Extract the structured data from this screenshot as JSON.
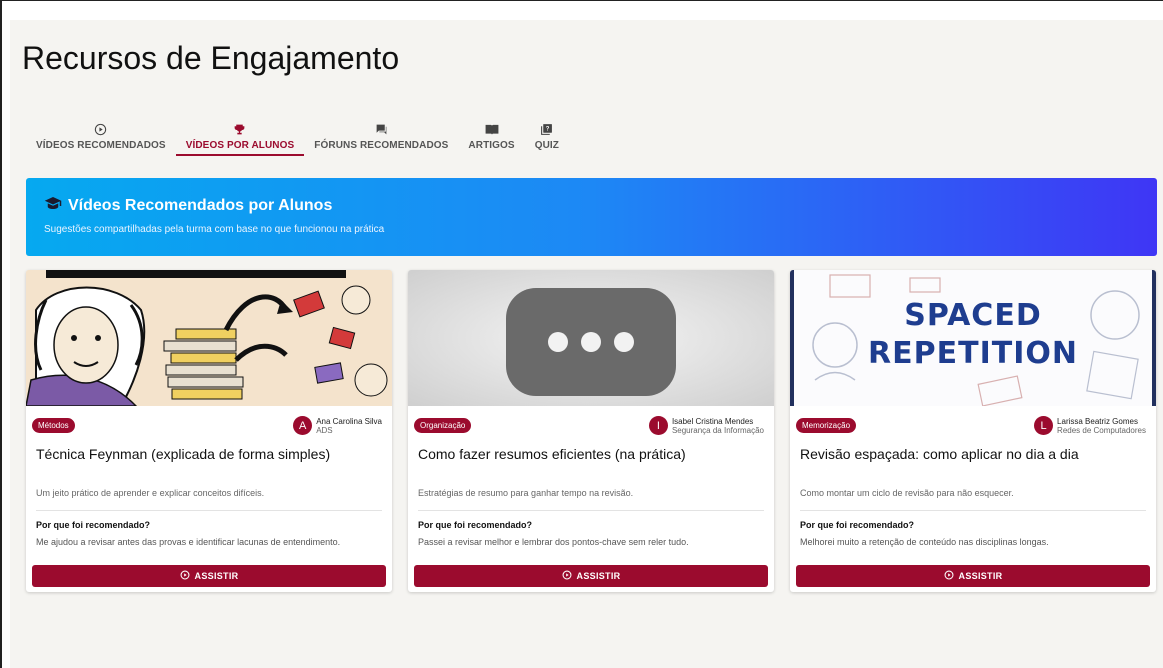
{
  "page": {
    "title": "Recursos de Engajamento"
  },
  "tabs": [
    {
      "label": "VÍDEOS RECOMENDADOS",
      "icon": "play-circle-icon",
      "active": false
    },
    {
      "label": "VÍDEOS POR ALUNOS",
      "icon": "trophy-icon",
      "active": true
    },
    {
      "label": "FÓRUNS RECOMENDADOS",
      "icon": "forum-icon",
      "active": false
    },
    {
      "label": "ARTIGOS",
      "icon": "book-icon",
      "active": false
    },
    {
      "label": "QUIZ",
      "icon": "quiz-icon",
      "active": false
    }
  ],
  "banner": {
    "title": "Vídeos Recomendados por Alunos",
    "subtitle": "Sugestões compartilhadas pela turma com base no que funcionou na prática",
    "icon": "graduation-cap-icon"
  },
  "cards": [
    {
      "category": "Métodos",
      "author_initial": "A",
      "author_name": "Ana Carolina Silva",
      "author_course": "ADS",
      "title": "Técnica Feynman (explicada de forma simples)",
      "description": "Um jeito prático de aprender e explicar conceitos difíceis.",
      "why_label": "Por que foi recomendado?",
      "why_text": "Me ajudou a revisar antes das provas e identificar lacunas de entendimento.",
      "button_label": "ASSISTIR"
    },
    {
      "category": "Organização",
      "author_initial": "I",
      "author_name": "Isabel Cristina Mendes",
      "author_course": "Segurança da Informação",
      "title": "Como fazer resumos eficientes (na prática)",
      "description": "Estratégias de resumo para ganhar tempo na revisão.",
      "why_label": "Por que foi recomendado?",
      "why_text": "Passei a revisar melhor e lembrar dos pontos-chave sem reler tudo.",
      "button_label": "ASSISTIR"
    },
    {
      "category": "Memorização",
      "author_initial": "L",
      "author_name": "Larissa Beatriz Gomes",
      "author_course": "Redes de Computadores",
      "title": "Revisão espaçada: como aplicar no dia a dia",
      "description": "Como montar um ciclo de revisão para não esquecer.",
      "why_label": "Por que foi recomendado?",
      "why_text": "Melhorei muito a retenção de conteúdo nas disciplinas longas.",
      "button_label": "ASSISTIR",
      "thumb_text_1": "SPACED",
      "thumb_text_2": "REPETITION"
    }
  ],
  "colors": {
    "accent": "#9b0b2e",
    "banner_start": "#06a9f0",
    "banner_end": "#3f36f5"
  }
}
